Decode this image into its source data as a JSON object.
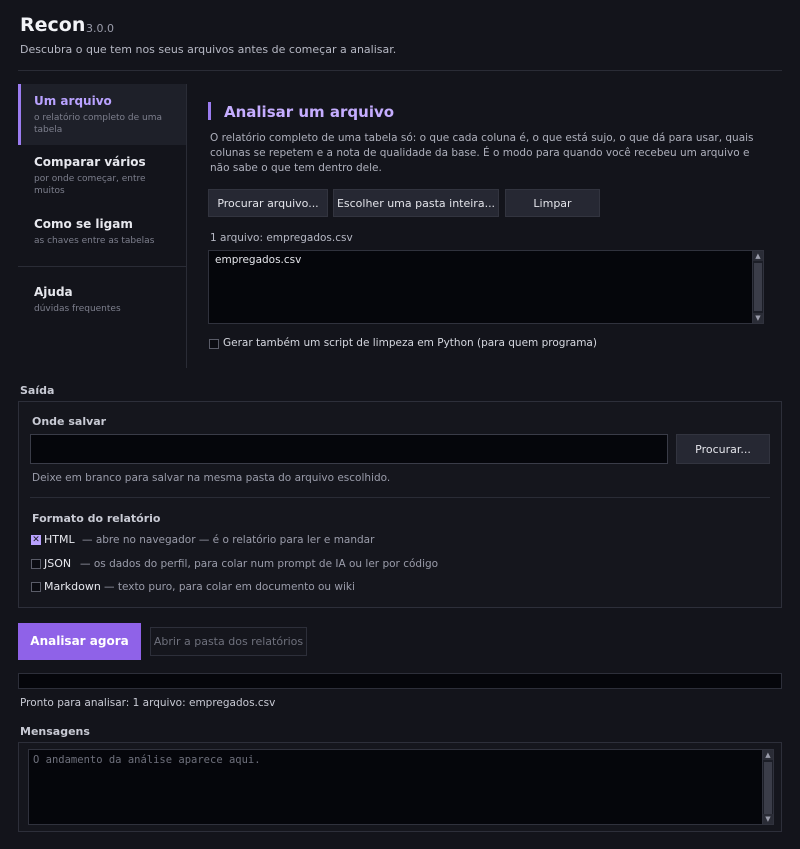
{
  "app": {
    "title": "Recon",
    "version": "3.0.0",
    "subtitle": "Descubra o que tem nos seus arquivos antes de começar a analisar."
  },
  "sidebar": {
    "items": [
      {
        "title": "Um arquivo",
        "desc": "o relatório completo de uma tabela",
        "active": true
      },
      {
        "title": "Comparar vários",
        "desc": "por onde começar, entre muitos",
        "active": false
      },
      {
        "title": "Como se ligam",
        "desc": "as chaves entre as tabelas",
        "active": false
      },
      {
        "title": "Ajuda",
        "desc": "dúvidas frequentes",
        "active": false
      }
    ]
  },
  "main": {
    "title": "Analisar um arquivo",
    "description": "O relatório completo de uma tabela só: o que cada coluna é, o que está sujo, o que dá para usar, quais colunas se repetem e a nota de qualidade da base. É o modo para quando você recebeu um arquivo e não sabe o que tem dentro dele.",
    "buttons": {
      "browse_file": "Procurar arquivo...",
      "choose_folder": "Escolher uma pasta inteira...",
      "clear": "Limpar"
    },
    "file_count": "1 arquivo: empregados.csv",
    "files": [
      "empregados.csv"
    ],
    "python_script_option": "Gerar também um script de limpeza em Python (para quem programa)",
    "python_script_checked": false
  },
  "output": {
    "section_label": "Saída",
    "where_label": "Onde salvar",
    "path_value": "",
    "browse_button": "Procurar...",
    "hint": "Deixe em branco para salvar na mesma pasta do arquivo escolhido.",
    "format_label": "Formato do relatório",
    "formats": [
      {
        "name": "HTML",
        "desc": "— abre no navegador — é o relatório para ler e mandar",
        "checked": true
      },
      {
        "name": "JSON",
        "desc": "— os dados do perfil, para colar num prompt de IA ou ler por código",
        "checked": false
      },
      {
        "name": "Markdown",
        "desc": "— texto puro, para colar em documento ou wiki",
        "checked": false
      }
    ]
  },
  "actions": {
    "analyze": "Analisar agora",
    "open_folder": "Abrir a pasta dos relatórios"
  },
  "progress": 0,
  "status": "Pronto para analisar: 1 arquivo: empregados.csv",
  "messages": {
    "label": "Mensagens",
    "placeholder": "O andamento da análise aparece aqui."
  },
  "colors": {
    "accent": "#9b7cf0",
    "primary_button": "#8f62e8",
    "background": "#13141b"
  }
}
